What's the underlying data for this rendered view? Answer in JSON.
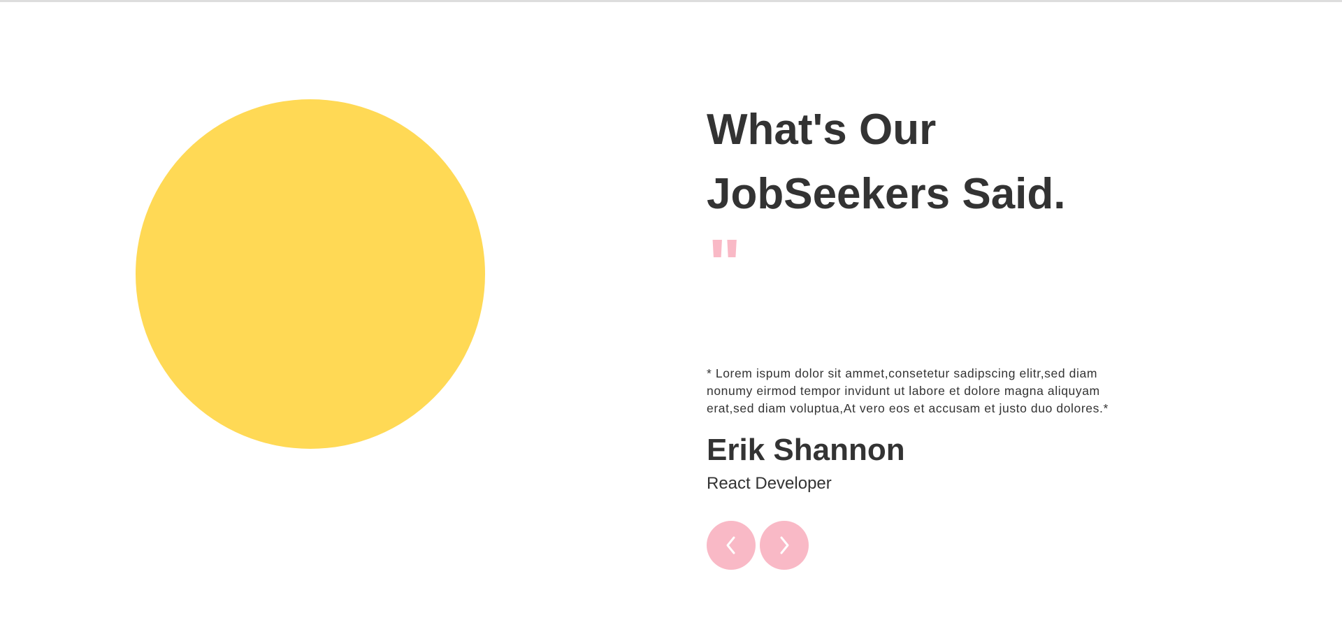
{
  "section": {
    "heading": "What's Our JobSeekers Said.",
    "quote_mark": "\"",
    "accent_color": "#F9B9C6",
    "circle_color": "#FFD955"
  },
  "testimonial": {
    "text": "* Lorem ispum dolor sit ammet,consetetur sadipscing elitr,sed diam nonumy eirmod tempor invidunt ut labore et dolore magna aliquyam erat,sed diam voluptua,At vero eos et accusam et justo duo dolores.*",
    "author_name": "Erik Shannon",
    "author_role": "React Developer"
  },
  "navigation": {
    "prev_icon": "chevron-left-icon",
    "next_icon": "chevron-right-icon"
  }
}
